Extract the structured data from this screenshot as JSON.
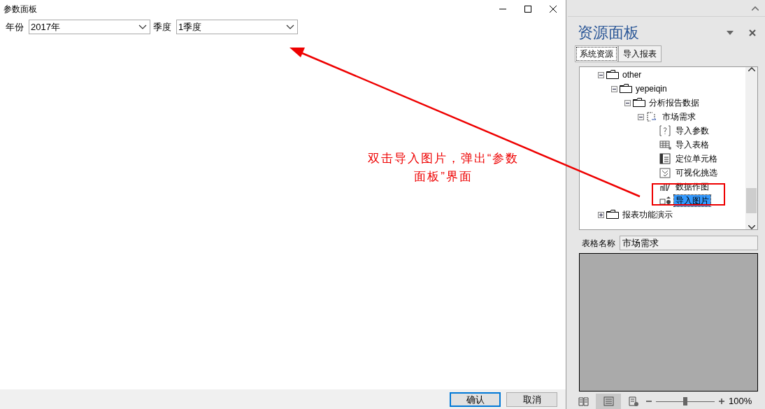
{
  "dialog": {
    "title": "参数面板",
    "params": [
      {
        "label": "年份",
        "value": "2017年"
      },
      {
        "label": "季度",
        "value": "1季度"
      }
    ],
    "buttons": [
      {
        "label": "确认",
        "default": true
      },
      {
        "label": "取消",
        "default": false
      }
    ]
  },
  "annotation": {
    "text": "双击导入图片，弹出“参数面板”界面"
  },
  "resource_panel": {
    "title": "资源面板",
    "tabs": [
      {
        "label": "系统资源",
        "selected": true
      },
      {
        "label": "导入报表",
        "selected": false
      }
    ],
    "tree": [
      {
        "kind": "folder",
        "label": "other",
        "expanded": true,
        "selected": false,
        "children": [
          {
            "kind": "folder",
            "label": "yepeiqin",
            "expanded": true,
            "selected": false,
            "children": [
              {
                "kind": "folder",
                "label": "分析报告数据",
                "expanded": true,
                "selected": false,
                "children": [
                  {
                    "kind": "report",
                    "label": "市场需求",
                    "expanded": true,
                    "selected": false,
                    "children": [
                      {
                        "kind": "param",
                        "label": "导入参数",
                        "selected": false
                      },
                      {
                        "kind": "table",
                        "label": "导入表格",
                        "selected": false
                      },
                      {
                        "kind": "cell",
                        "label": "定位单元格",
                        "selected": false
                      },
                      {
                        "kind": "filter",
                        "label": "可视化挑选",
                        "selected": false
                      },
                      {
                        "kind": "chart",
                        "label": "数据作图",
                        "selected": false
                      },
                      {
                        "kind": "picture",
                        "label": "导入图片",
                        "selected": true
                      }
                    ]
                  }
                ]
              }
            ]
          }
        ]
      },
      {
        "kind": "folder",
        "label": "报表功能演示",
        "expanded": false,
        "selected": false
      }
    ],
    "table_name": {
      "label": "表格名称",
      "value": "市场需求"
    }
  },
  "status_bar": {
    "views": [
      {
        "kind": "read",
        "selected": false
      },
      {
        "kind": "page",
        "selected": true
      },
      {
        "kind": "web",
        "selected": false
      }
    ],
    "zoom": "100%",
    "level": 0.5
  }
}
